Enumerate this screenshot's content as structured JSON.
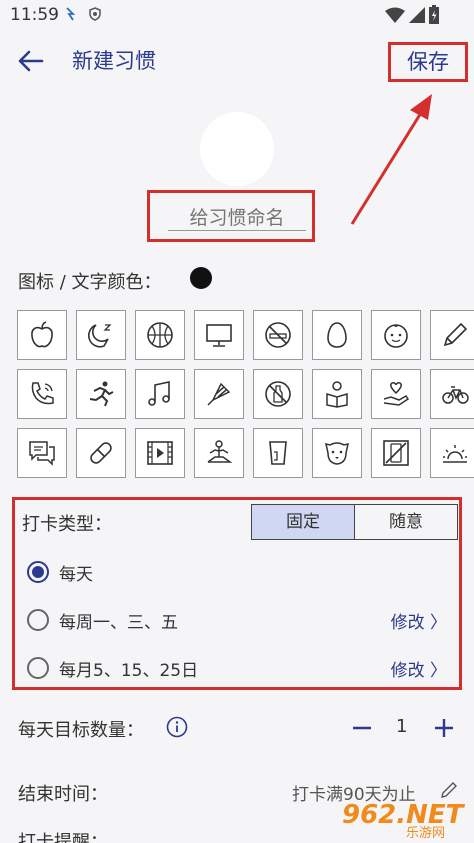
{
  "status_bar": {
    "time": "11:59"
  },
  "app_bar": {
    "title": "新建习惯",
    "save_label": "保存"
  },
  "name_input": {
    "placeholder": "给习惯命名"
  },
  "color": {
    "label": "图标 / 文字颜色：",
    "selected": "#111111"
  },
  "icons": [
    "apple-icon",
    "moon-sleep-icon",
    "basketball-icon",
    "monitor-icon",
    "no-smoking-icon",
    "egg-icon",
    "baby-icon",
    "pencil-icon",
    "phone-icon",
    "running-icon",
    "music-icon",
    "badminton-icon",
    "no-drinking-icon",
    "reading-icon",
    "heart-hand-icon",
    "bicycle-icon",
    "chat-icon",
    "pill-icon",
    "video-icon",
    "meditation-icon",
    "cup-icon",
    "dog-icon",
    "no-phone-icon",
    "sunrise-icon"
  ],
  "checkin": {
    "type_label": "打卡类型：",
    "modes": [
      "固定",
      "随意"
    ],
    "active_mode": "固定",
    "options": [
      {
        "label": "每天",
        "selected": true,
        "edit": ""
      },
      {
        "label": "每周一、三、五",
        "selected": false,
        "edit": "修改 〉"
      },
      {
        "label": "每月5、15、25日",
        "selected": false,
        "edit": "修改 〉"
      }
    ]
  },
  "target": {
    "label": "每天目标数量：",
    "value": "1"
  },
  "end_time": {
    "label": "结束时间：",
    "value": "打卡满90天为止"
  },
  "reminder": {
    "label": "打卡提醒："
  },
  "watermark": {
    "main": "962.NET",
    "sub": "乐游网"
  },
  "colors": {
    "accent": "#2b3a8c",
    "highlight": "#d32f2f",
    "segment_active": "#cfd7f2"
  }
}
